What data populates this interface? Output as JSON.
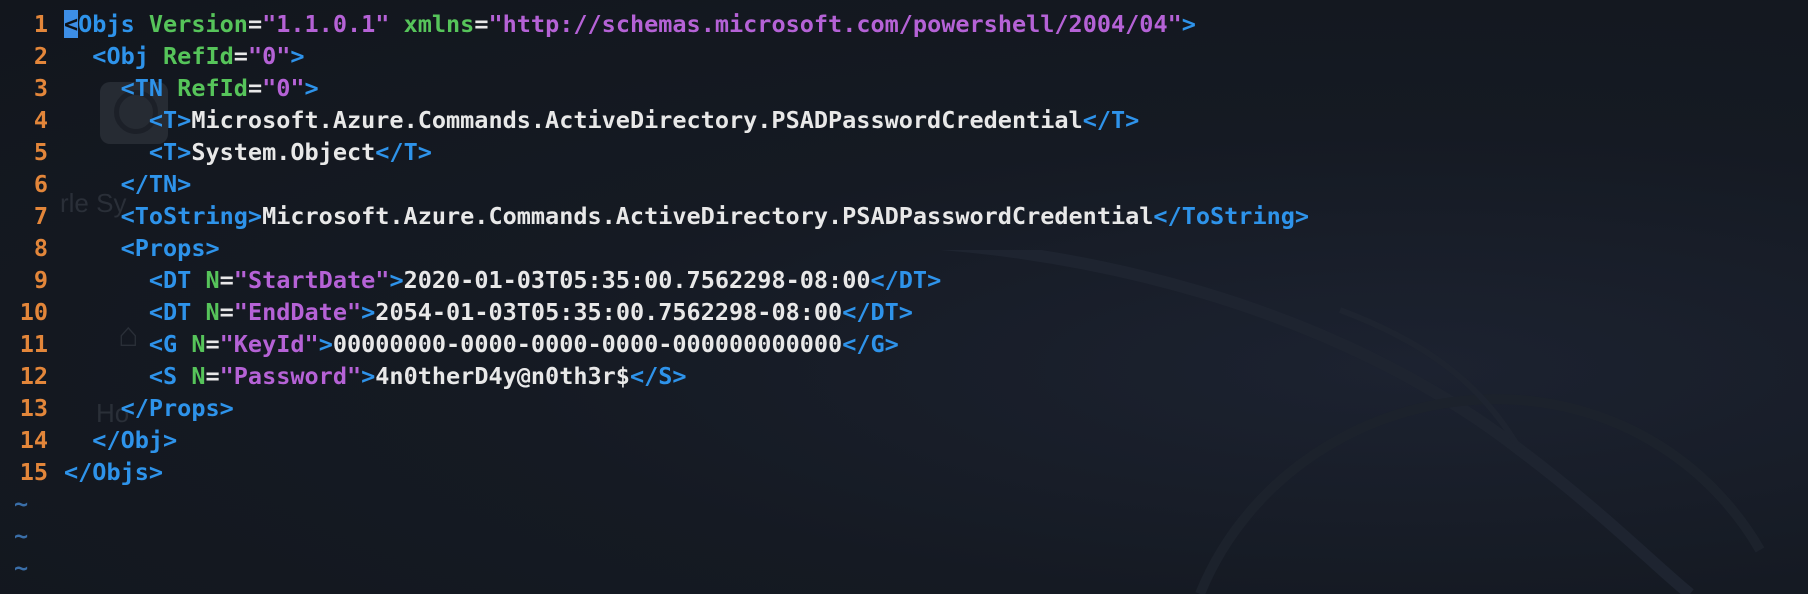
{
  "editor": {
    "empty_line_marker": "~",
    "lines": [
      {
        "number": "1",
        "cursor": "<",
        "tokens": [
          {
            "k": "p",
            "v": "Objs"
          },
          {
            "k": "a",
            "v": " Version"
          },
          {
            "k": "t",
            "v": "="
          },
          {
            "k": "s",
            "v": "\"1.1.0.1\""
          },
          {
            "k": "a",
            "v": " xmlns"
          },
          {
            "k": "t",
            "v": "="
          },
          {
            "k": "s",
            "v": "\"http://schemas.microsoft.com/powershell/2004/04\""
          },
          {
            "k": "p",
            "v": ">"
          }
        ]
      },
      {
        "number": "2",
        "tokens": [
          {
            "k": "t",
            "v": "  "
          },
          {
            "k": "p",
            "v": "<Obj"
          },
          {
            "k": "a",
            "v": " RefId"
          },
          {
            "k": "t",
            "v": "="
          },
          {
            "k": "s",
            "v": "\"0\""
          },
          {
            "k": "p",
            "v": ">"
          }
        ]
      },
      {
        "number": "3",
        "tokens": [
          {
            "k": "t",
            "v": "    "
          },
          {
            "k": "p",
            "v": "<TN"
          },
          {
            "k": "a",
            "v": " RefId"
          },
          {
            "k": "t",
            "v": "="
          },
          {
            "k": "s",
            "v": "\"0\""
          },
          {
            "k": "p",
            "v": ">"
          }
        ]
      },
      {
        "number": "4",
        "tokens": [
          {
            "k": "t",
            "v": "      "
          },
          {
            "k": "p",
            "v": "<T>"
          },
          {
            "k": "t",
            "v": "Microsoft.Azure.Commands.ActiveDirectory.PSADPasswordCredential"
          },
          {
            "k": "p",
            "v": "</T>"
          }
        ]
      },
      {
        "number": "5",
        "tokens": [
          {
            "k": "t",
            "v": "      "
          },
          {
            "k": "p",
            "v": "<T>"
          },
          {
            "k": "t",
            "v": "System.Object"
          },
          {
            "k": "p",
            "v": "</T>"
          }
        ]
      },
      {
        "number": "6",
        "tokens": [
          {
            "k": "t",
            "v": "    "
          },
          {
            "k": "p",
            "v": "</TN>"
          }
        ]
      },
      {
        "number": "7",
        "tokens": [
          {
            "k": "t",
            "v": "    "
          },
          {
            "k": "p",
            "v": "<ToString>"
          },
          {
            "k": "t",
            "v": "Microsoft.Azure.Commands.ActiveDirectory.PSADPasswordCredential"
          },
          {
            "k": "p",
            "v": "</ToString>"
          }
        ]
      },
      {
        "number": "8",
        "tokens": [
          {
            "k": "t",
            "v": "    "
          },
          {
            "k": "p",
            "v": "<Props>"
          }
        ]
      },
      {
        "number": "9",
        "tokens": [
          {
            "k": "t",
            "v": "      "
          },
          {
            "k": "p",
            "v": "<DT"
          },
          {
            "k": "a",
            "v": " N"
          },
          {
            "k": "t",
            "v": "="
          },
          {
            "k": "s",
            "v": "\"StartDate\""
          },
          {
            "k": "p",
            "v": ">"
          },
          {
            "k": "t",
            "v": "2020-01-03T05:35:00.7562298-08:00"
          },
          {
            "k": "p",
            "v": "</DT>"
          }
        ]
      },
      {
        "number": "10",
        "tokens": [
          {
            "k": "t",
            "v": "      "
          },
          {
            "k": "p",
            "v": "<DT"
          },
          {
            "k": "a",
            "v": " N"
          },
          {
            "k": "t",
            "v": "="
          },
          {
            "k": "s",
            "v": "\"EndDate\""
          },
          {
            "k": "p",
            "v": ">"
          },
          {
            "k": "t",
            "v": "2054-01-03T05:35:00.7562298-08:00"
          },
          {
            "k": "p",
            "v": "</DT>"
          }
        ]
      },
      {
        "number": "11",
        "tokens": [
          {
            "k": "t",
            "v": "      "
          },
          {
            "k": "p",
            "v": "<G"
          },
          {
            "k": "a",
            "v": " N"
          },
          {
            "k": "t",
            "v": "="
          },
          {
            "k": "s",
            "v": "\"KeyId\""
          },
          {
            "k": "p",
            "v": ">"
          },
          {
            "k": "t",
            "v": "00000000-0000-0000-0000-000000000000"
          },
          {
            "k": "p",
            "v": "</G>"
          }
        ]
      },
      {
        "number": "12",
        "tokens": [
          {
            "k": "t",
            "v": "      "
          },
          {
            "k": "p",
            "v": "<S"
          },
          {
            "k": "a",
            "v": " N"
          },
          {
            "k": "t",
            "v": "="
          },
          {
            "k": "s",
            "v": "\"Password\""
          },
          {
            "k": "p",
            "v": ">"
          },
          {
            "k": "t",
            "v": "4n0therD4y@n0th3r$"
          },
          {
            "k": "p",
            "v": "</S>"
          }
        ]
      },
      {
        "number": "13",
        "tokens": [
          {
            "k": "t",
            "v": "    "
          },
          {
            "k": "p",
            "v": "</Props>"
          }
        ]
      },
      {
        "number": "14",
        "tokens": [
          {
            "k": "t",
            "v": "  "
          },
          {
            "k": "p",
            "v": "</Obj>"
          }
        ]
      },
      {
        "number": "15",
        "tokens": [
          {
            "k": "p",
            "v": "</Objs>"
          }
        ]
      }
    ],
    "empty_lines": 3
  },
  "background": {
    "ghost_label_1": "rle Sy",
    "ghost_label_2": "Ho"
  },
  "colors": {
    "tag": "#2e93ea",
    "attribute": "#56c45a",
    "string": "#b562d6",
    "text": "#e8e8e8",
    "line_number": "#e3863a",
    "tilde": "#3a6ea8",
    "cursor": "#3d8ee6"
  }
}
